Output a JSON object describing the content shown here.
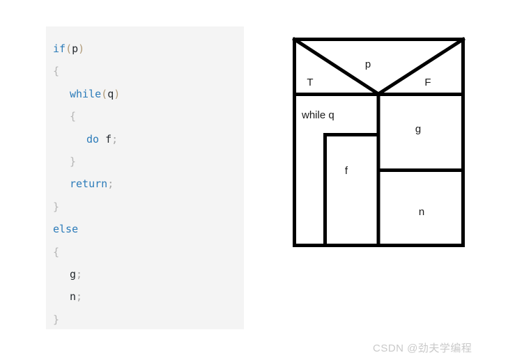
{
  "code_panel": {
    "language": "c",
    "background_color": "#f4f4f4",
    "keyword_color": "#2b7bb9",
    "identifier_color": "#24292e",
    "punctuation_color": "#a6a6a6",
    "lines": [
      {
        "indent": 0,
        "tokens": [
          {
            "t": "if",
            "c": "kw"
          },
          {
            "t": "(",
            "c": "paren"
          },
          {
            "t": "p",
            "c": "id"
          },
          {
            "t": ")",
            "c": "paren"
          }
        ]
      },
      {
        "indent": 0,
        "tokens": [
          {
            "t": "{",
            "c": "brace"
          }
        ]
      },
      {
        "indent": 1,
        "tokens": [
          {
            "t": "while",
            "c": "kw"
          },
          {
            "t": "(",
            "c": "paren"
          },
          {
            "t": "q",
            "c": "id"
          },
          {
            "t": ")",
            "c": "paren"
          }
        ]
      },
      {
        "indent": 1,
        "tokens": [
          {
            "t": "{",
            "c": "brace"
          }
        ]
      },
      {
        "indent": 2,
        "tokens": [
          {
            "t": "do",
            "c": "kw"
          },
          {
            "t": " ",
            "c": "id"
          },
          {
            "t": "f",
            "c": "id"
          },
          {
            "t": ";",
            "c": "punc"
          }
        ]
      },
      {
        "indent": 1,
        "tokens": [
          {
            "t": "}",
            "c": "brace"
          }
        ]
      },
      {
        "indent": 1,
        "tokens": [
          {
            "t": "return",
            "c": "kw"
          },
          {
            "t": ";",
            "c": "punc"
          }
        ]
      },
      {
        "indent": 0,
        "tokens": [
          {
            "t": "}",
            "c": "brace"
          }
        ]
      },
      {
        "indent": 0,
        "tokens": [
          {
            "t": "else",
            "c": "kw"
          }
        ]
      },
      {
        "indent": 0,
        "tokens": [
          {
            "t": "{",
            "c": "brace"
          }
        ]
      },
      {
        "indent": 1,
        "tokens": [
          {
            "t": "g",
            "c": "id"
          },
          {
            "t": ";",
            "c": "punc"
          }
        ]
      },
      {
        "indent": 1,
        "tokens": [
          {
            "t": "n",
            "c": "id"
          },
          {
            "t": ";",
            "c": "punc"
          }
        ]
      },
      {
        "indent": 0,
        "tokens": [
          {
            "t": "}",
            "c": "brace"
          }
        ]
      }
    ],
    "plain_text": "if(p)\n{\n    while(q)\n    {\n        do f;\n    }\n    return;\n}\nelse\n{\n    g;\n    n;\n}"
  },
  "structogram": {
    "type": "nassi-shneiderman",
    "stroke_color": "#000000",
    "decision": {
      "condition_label": "p",
      "true_label": "T",
      "false_label": "F"
    },
    "true_branch": {
      "loop_label": "while q",
      "body_label": "f"
    },
    "false_branch": {
      "first_label": "g",
      "second_label": "n"
    }
  },
  "watermark": {
    "text": "CSDN @劲夫学编程"
  }
}
